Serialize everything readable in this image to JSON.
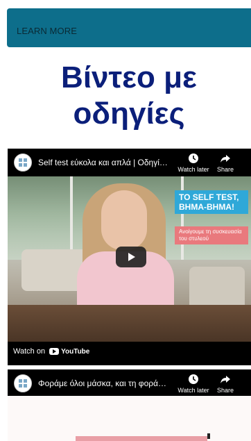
{
  "banner": {
    "learn_more": "LEARN MORE"
  },
  "heading": {
    "line1": "Βίντεο με",
    "line2": "οδηγίες"
  },
  "videos": [
    {
      "title": "Self test εύκολα και απλά | Οδηγίες ...",
      "watch_later": "Watch later",
      "share": "Share",
      "badge_title": "TO SELF TEST, ΒΗΜΑ-ΒΗΜΑ!",
      "badge_subtitle": "Ανοίγουμε τη συσκευασία του στυλεού",
      "watch_on": "Watch on",
      "youtube": "YouTube"
    },
    {
      "title": "Φοράμε όλοι μάσκα, και τη φοράμε ...",
      "watch_later": "Watch later",
      "share": "Share"
    }
  ],
  "colors": {
    "banner": "#0d6e8b",
    "heading": "#0b1f7a"
  }
}
